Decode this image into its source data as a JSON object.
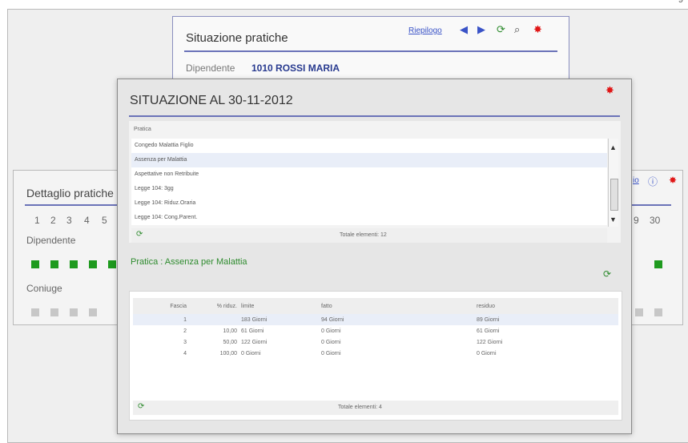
{
  "page_number": "9",
  "situazione": {
    "title": "Situazione pratiche",
    "riepilogo_label": "Riepilogo",
    "dipendente_label": "Dipendente",
    "dipendente_value": "1010 ROSSI MARIA"
  },
  "dettaglio": {
    "title": "Dettaglio pratiche",
    "days": [
      "1",
      "2",
      "3",
      "4",
      "5"
    ],
    "right_days": [
      "9",
      "30"
    ],
    "dipendente_label": "Dipendente",
    "coniuge_label": "Coniuge",
    "riepilogo_label": "io"
  },
  "modal": {
    "title": "SITUAZIONE AL 30-11-2012",
    "list_header": "Pratica",
    "list_items": [
      "Congedo Malattia Figlio",
      "Assenza per Malattia",
      "Aspettative non Retribuite",
      "Legge 104: 3gg",
      "Legge 104: Riduz.Oraria",
      "Legge 104: Cong.Parent."
    ],
    "selected_index": 1,
    "list_total": "Totale elementi: 12",
    "pratica_label": "Pratica : Assenza per Malattia",
    "table": {
      "headers": [
        "Fascia",
        "% riduz.",
        "limite",
        "fatto",
        "residuo"
      ],
      "rows": [
        [
          "1",
          "",
          "183 Giorni",
          "94 Giorni",
          "89 Giorni"
        ],
        [
          "2",
          "10,00",
          "61 Giorni",
          "0 Giorni",
          "61 Giorni"
        ],
        [
          "3",
          "50,00",
          "122 Giorni",
          "0 Giorni",
          "122 Giorni"
        ],
        [
          "4",
          "100,00",
          "0 Giorni",
          "0 Giorni",
          "0 Giorni"
        ]
      ],
      "selected_row": 0,
      "total": "Totale elementi: 4"
    }
  },
  "icons": {
    "left_arrow": "left-triangle-icon",
    "right_arrow": "right-triangle-icon",
    "refresh": "refresh-icon",
    "binoculars": "binoculars-icon",
    "close": "close-icon",
    "info": "info-icon"
  },
  "colors": {
    "accent_rule": "#6b73b8",
    "link": "#3a53c7",
    "green": "#2e8b2e",
    "close_red": "#e01616"
  }
}
